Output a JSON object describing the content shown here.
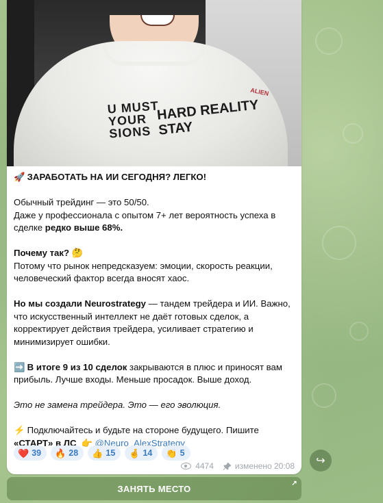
{
  "post": {
    "headline_emoji": "🚀",
    "headline": "ЗАРАБОТАТЬ НА ИИ СЕГОДНЯ? ЛЕГКО!",
    "p1_line1": "Обычный трейдинг — это 50/50.",
    "p1_line2_pre": "Даже у профессионала с опытом 7+ лет вероятность успеха в сделке ",
    "p1_line2_bold": "редко выше 68%.",
    "q_bold": "Почему так?",
    "q_emoji": "🤔",
    "p2": "Потому что рынок непредсказуем: эмоции, скорость реакции, человеческий фактор всегда вносят хаос.",
    "p3_bold": "Но мы создали Neurostrategy",
    "p3_rest": " — тандем трейдера и ИИ. Важно, что искусственный интеллект не даёт готовых сделок, а корректирует действия трейдера, усиливает стратегию и минимизирует ошибки.",
    "p4_emoji": "➡️",
    "p4_bold": "В итоге 9 из 10 сделок",
    "p4_rest": " закрываются в плюс и приносят вам прибыль. Лучше входы. Меньше просадок. Выше доход.",
    "p5_italic": "Это не замена трейдера. Это — его эволюция.",
    "p6_emoji": "⚡",
    "p6_pre": " Подключайтесь и будьте на стороне будущего. Пишите ",
    "p6_bold": "«СТАРТ» в ЛС",
    "p6_point": "👉",
    "p6_link": "@Neuro_AlexStrategy"
  },
  "reactions": [
    {
      "icon": "❤️",
      "count": "39"
    },
    {
      "icon": "🔥",
      "count": "28"
    },
    {
      "icon": "👍",
      "count": "15"
    },
    {
      "icon": "🤞",
      "count": "14"
    },
    {
      "icon": "👏",
      "count": "5"
    }
  ],
  "meta": {
    "views": "4474",
    "edited": "изменено 20:08"
  },
  "cta": {
    "label": "ЗАНЯТЬ МЕСТО",
    "corner": "↗"
  },
  "share": {
    "icon": "↪"
  },
  "photo_print": {
    "left": "U MUST\nYOUR\nSIONS",
    "right": "HARD REALITY\nSTAY",
    "side": "ALIEN"
  }
}
